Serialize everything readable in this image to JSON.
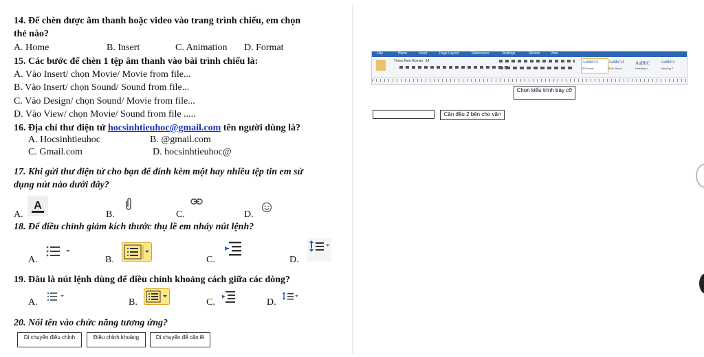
{
  "q14": {
    "text": "14. Để chèn được âm thanh hoặc video vào trang trình chiếu, em chọn",
    "text2": "thẻ nào?",
    "a": "A. Home",
    "b": "B. Insert",
    "c": "C. Animation",
    "d": "D. Format"
  },
  "q15": {
    "text": "15. Các bước để chèn 1 tệp âm thanh vào bài trình chiếu là:",
    "a": "A. Vào Insert/ chọn Movie/ Movie from file...",
    "b": "B. Vào Insert/ chọn Sound/ Sound from file...",
    "c": "C. Vào Design/ chọn Sound/ Movie from file...",
    "d": "D. Vào View/ chọn Movie/ Sound from file ....."
  },
  "q16": {
    "prefix": "16.  Địa chỉ thư điện tử ",
    "email": "hocsinhtieuhoc@gmail.com",
    "suffix": " tên người dùng là?",
    "a": "A. Hocsinhtieuhoc",
    "b": "B. @gmail.com",
    "c": "C. Gmail.com",
    "d": "D. hocsinhtieuhoc@"
  },
  "q17": {
    "text": "17.  Khi gửi thư điện tử cho bạn để đính kèm một hay nhiều tệp tin em sử",
    "text2": "dụng nút nào dưới đây?",
    "a": "A.",
    "b": "B.",
    "c": "C.",
    "d": "D.",
    "icons": [
      "font-color-icon",
      "paperclip-icon",
      "link-icon",
      "smiley-icon"
    ]
  },
  "q18": {
    "text": "18. Để điều chỉnh giảm kích thước thụ lề em nháy nút lệnh?",
    "a": "A.",
    "b": "B.",
    "c": "C.",
    "d": "D.",
    "icons": [
      "bullet-list-icon",
      "numbered-list-icon",
      "decrease-indent-icon",
      "line-spacing-icon"
    ]
  },
  "q19": {
    "text": "19. Đâu là nút lệnh dùng để điều chỉnh khoảng cách giữa các dòng?",
    "a": "A.",
    "b": "B.",
    "c": "C.",
    "d": "D.",
    "icons": [
      "bullet-list-icon",
      "numbered-list-icon",
      "decrease-indent-icon",
      "line-spacing-icon"
    ]
  },
  "q20": {
    "text": "20.  Nối tên vào chức năng tương ứng?",
    "boxes": [
      "Di chuyển điều chỉnh",
      "Điều chỉnh khoảng",
      "Di chuyển để căn lề"
    ]
  },
  "right": {
    "box_style": "Chọn kiểu trình bày cỡ",
    "box_small1": "",
    "box_small2": "Căn đều 2 bên cho văn",
    "ribbon_tabs": [
      "File",
      "Home",
      "Insert",
      "Page Layout",
      "References",
      "Mailings",
      "Review",
      "View"
    ],
    "ribbon_font": "Times New Roman",
    "ribbon_size": "14",
    "ribbon_styles": [
      "AaBbCcI",
      "AaBbCcI",
      "AaBbC",
      "AaBbCc"
    ],
    "ribbon_style_names": [
      "¶ Normal",
      "¶ No Spaci...",
      "Heading 1",
      "Heading 2"
    ]
  },
  "colors": {
    "link": "#1a33b3",
    "highlight": "#fde58a",
    "ribbon_tab": "#2c65b5"
  }
}
